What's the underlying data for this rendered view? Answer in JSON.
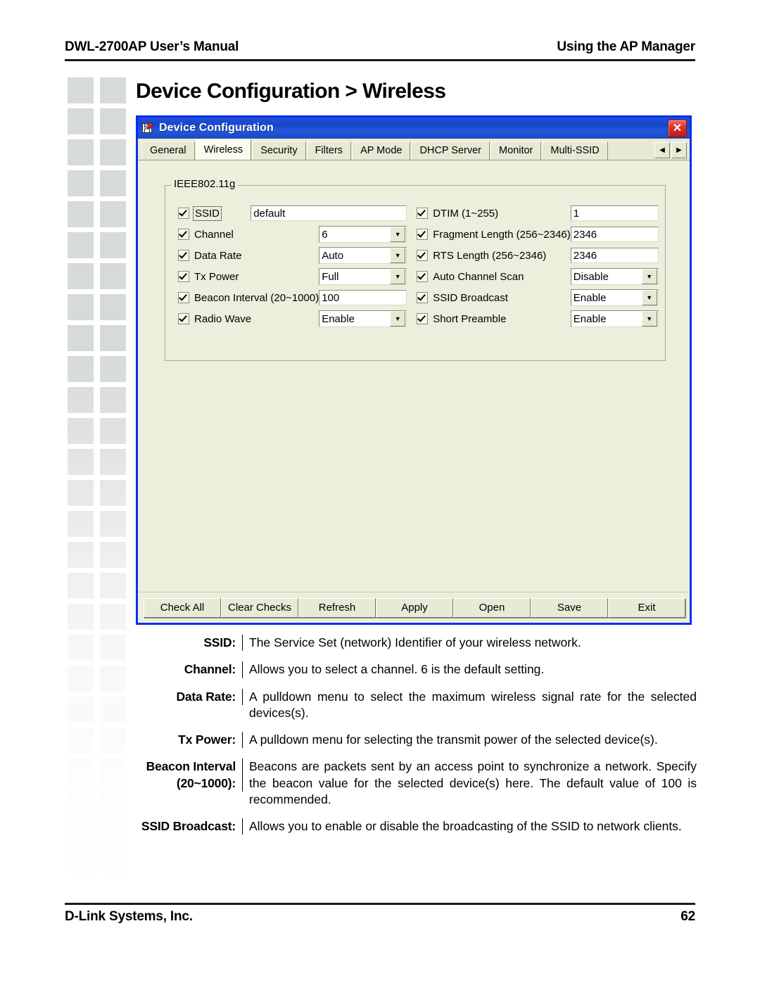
{
  "page": {
    "header_left": "DWL-2700AP User’s Manual",
    "header_right": "Using the AP Manager",
    "title": "Device Configuration > Wireless",
    "footer_left": "D-Link Systems, Inc.",
    "footer_right": "62"
  },
  "dialog": {
    "title": "Device Configuration",
    "icon": "save-device-icon",
    "close_label": "✕",
    "tabs": [
      {
        "label": "General",
        "selected": false
      },
      {
        "label": "Wireless",
        "selected": true
      },
      {
        "label": "Security",
        "selected": false
      },
      {
        "label": "Filters",
        "selected": false
      },
      {
        "label": "AP Mode",
        "selected": false
      },
      {
        "label": "DHCP Server",
        "selected": false
      },
      {
        "label": "Monitor",
        "selected": false
      },
      {
        "label": "Multi-SSID",
        "selected": false
      }
    ],
    "tab_scroll_left": "◀",
    "tab_scroll_right": "▶",
    "group_legend": "IEEE802.11g",
    "left_fields": [
      {
        "label": "SSID",
        "checked": true,
        "type": "text",
        "value": "default"
      },
      {
        "label": "Channel",
        "checked": true,
        "type": "combo",
        "value": "6"
      },
      {
        "label": "Data Rate",
        "checked": true,
        "type": "combo",
        "value": "Auto"
      },
      {
        "label": "Tx Power",
        "checked": true,
        "type": "combo",
        "value": "Full"
      },
      {
        "label": "Beacon Interval (20~1000)",
        "checked": true,
        "type": "text",
        "value": "100"
      },
      {
        "label": "Radio Wave",
        "checked": true,
        "type": "combo",
        "value": "Enable"
      }
    ],
    "right_fields": [
      {
        "label": "DTIM (1~255)",
        "checked": true,
        "type": "text",
        "value": "1"
      },
      {
        "label": "Fragment Length (256~2346)",
        "checked": true,
        "type": "text",
        "value": "2346"
      },
      {
        "label": "RTS Length (256~2346)",
        "checked": true,
        "type": "text",
        "value": "2346"
      },
      {
        "label": "Auto Channel Scan",
        "checked": true,
        "type": "combo",
        "value": "Disable"
      },
      {
        "label": "SSID Broadcast",
        "checked": true,
        "type": "combo",
        "value": "Enable"
      },
      {
        "label": "Short Preamble",
        "checked": true,
        "type": "combo",
        "value": "Enable"
      }
    ],
    "buttons": [
      "Check All",
      "Clear Checks",
      "Refresh",
      "Apply",
      "Open",
      "Save",
      "Exit"
    ]
  },
  "descriptions": [
    {
      "term": "SSID:",
      "term_line2": "",
      "text": "The Service Set (network) Identifier of your wireless network."
    },
    {
      "term": "Channel:",
      "term_line2": "",
      "text": "Allows you to select a channel. 6 is the default setting."
    },
    {
      "term": "Data Rate:",
      "term_line2": "",
      "text": "A pulldown menu to select the maximum wireless signal rate for the selected devices(s)."
    },
    {
      "term": "Tx Power:",
      "term_line2": "",
      "text": "A pulldown menu for selecting the transmit power of the selected device(s)."
    },
    {
      "term": "Beacon Interval",
      "term_line2": "(20~1000):",
      "text": "Beacons are packets sent by an access point to synchronize a network. Specify the beacon value for the selected device(s) here. The default value of 100 is recommended."
    },
    {
      "term": "SSID Broadcast:",
      "term_line2": "",
      "text": "Allows you to enable or disable the broadcasting of the SSID to network clients."
    }
  ],
  "colors": {
    "titlebar_blue": "#1745c8",
    "dialog_border": "#0a30f0",
    "dialog_bg": "#edeedb",
    "close_red": "#e03030",
    "deco_gray": "#d6dad9"
  }
}
